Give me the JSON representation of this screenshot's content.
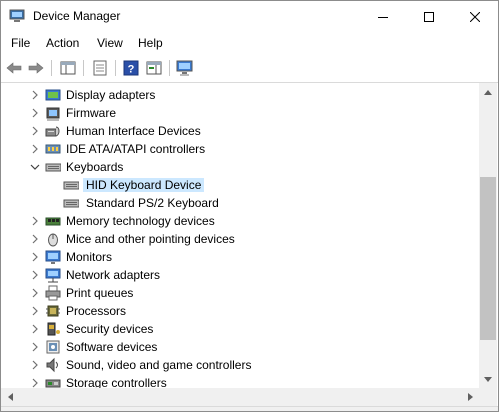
{
  "window": {
    "title": "Device Manager"
  },
  "menu": [
    "File",
    "Action",
    "View",
    "Help"
  ],
  "tree": [
    {
      "label": "Display adapters",
      "icon": "display-adapter-icon",
      "state": "collapsed"
    },
    {
      "label": "Firmware",
      "icon": "firmware-icon",
      "state": "collapsed"
    },
    {
      "label": "Human Interface Devices",
      "icon": "hid-icon",
      "state": "collapsed"
    },
    {
      "label": "IDE ATA/ATAPI controllers",
      "icon": "ide-controller-icon",
      "state": "collapsed"
    },
    {
      "label": "Keyboards",
      "icon": "keyboard-icon",
      "state": "expanded"
    },
    {
      "label": "HID Keyboard Device",
      "icon": "keyboard-icon",
      "state": "child",
      "selected": true
    },
    {
      "label": "Standard PS/2 Keyboard",
      "icon": "keyboard-icon",
      "state": "child"
    },
    {
      "label": "Memory technology devices",
      "icon": "memory-icon",
      "state": "collapsed"
    },
    {
      "label": "Mice and other pointing devices",
      "icon": "mouse-icon",
      "state": "collapsed"
    },
    {
      "label": "Monitors",
      "icon": "monitor-icon",
      "state": "collapsed"
    },
    {
      "label": "Network adapters",
      "icon": "network-adapter-icon",
      "state": "collapsed"
    },
    {
      "label": "Print queues",
      "icon": "printer-icon",
      "state": "collapsed"
    },
    {
      "label": "Processors",
      "icon": "processor-icon",
      "state": "collapsed"
    },
    {
      "label": "Security devices",
      "icon": "security-device-icon",
      "state": "collapsed"
    },
    {
      "label": "Software devices",
      "icon": "software-device-icon",
      "state": "collapsed"
    },
    {
      "label": "Sound, video and game controllers",
      "icon": "sound-icon",
      "state": "collapsed"
    },
    {
      "label": "Storage controllers",
      "icon": "storage-controller-icon",
      "state": "collapsed"
    }
  ],
  "colors": {
    "selection": "#cce8ff",
    "accent": "#0078d7"
  }
}
